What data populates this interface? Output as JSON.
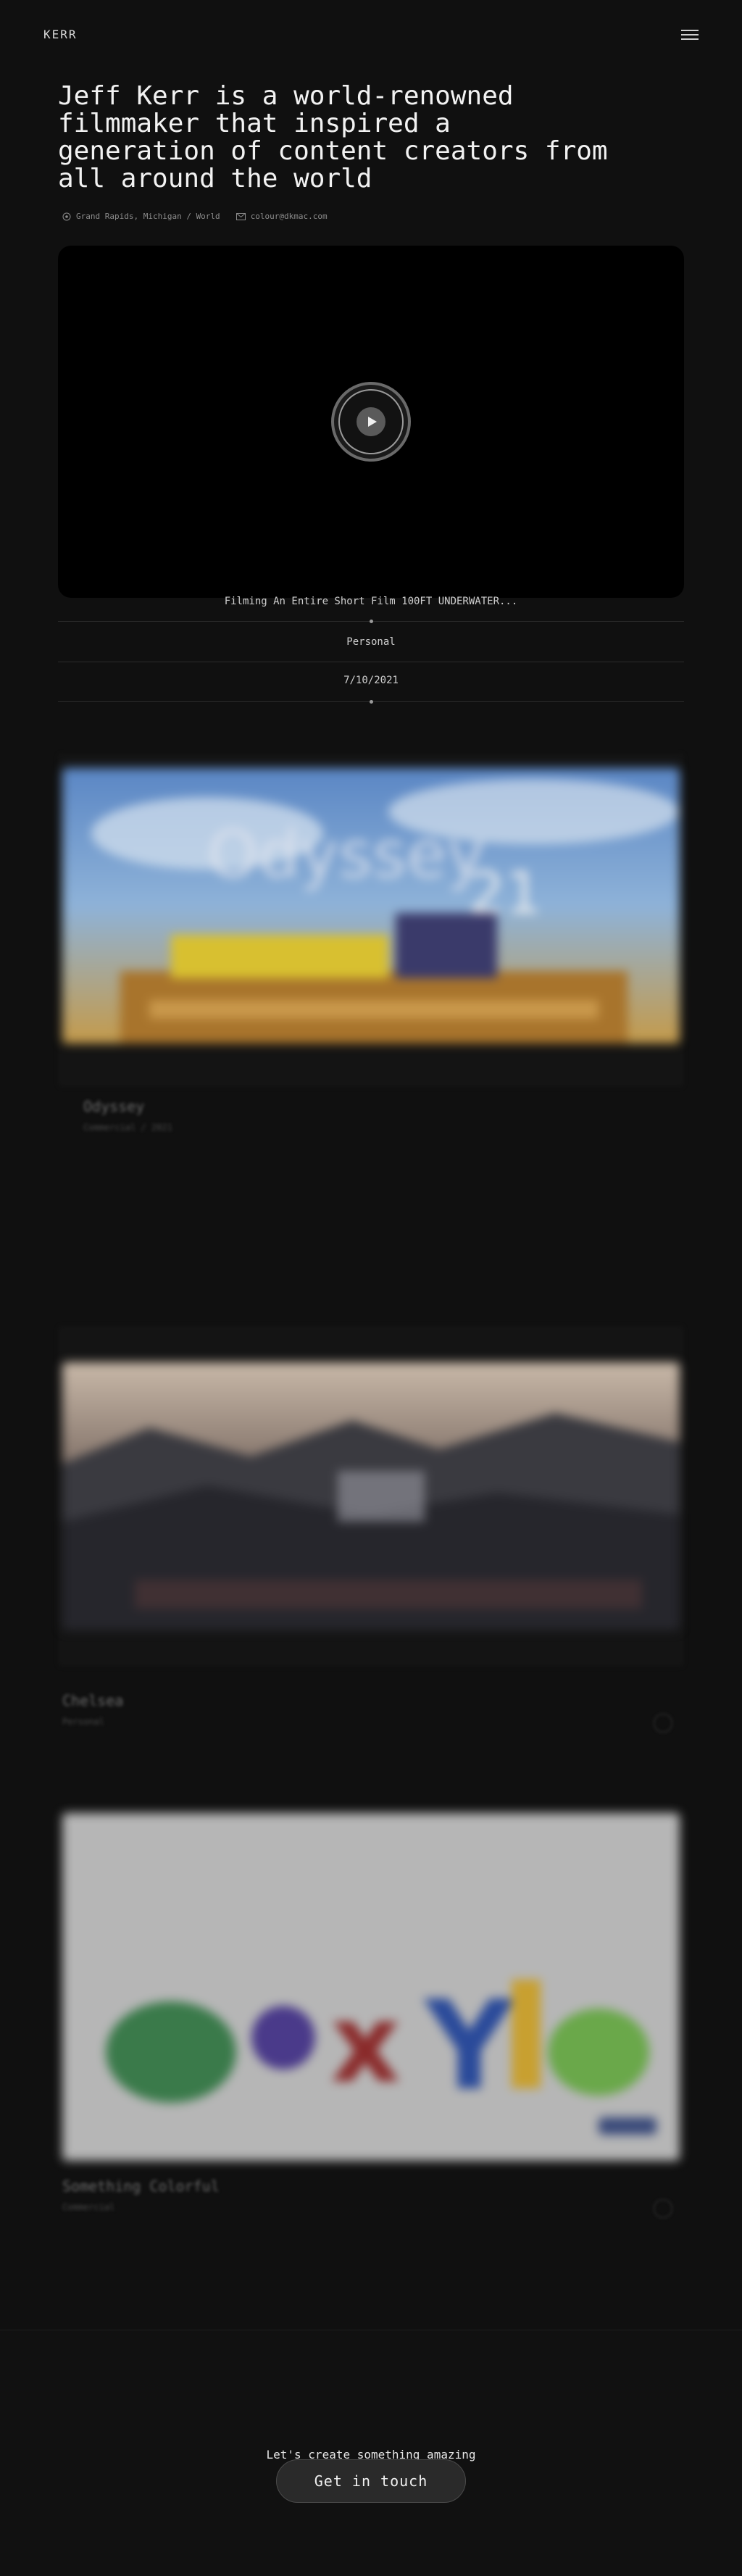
{
  "header": {
    "logo": "KERR",
    "menu_icon": "hamburger-menu-icon"
  },
  "hero": {
    "title": "Jeff Kerr is a world-renowned filmmaker that inspired a generation of content creators from all around the world",
    "location": "Grand Rapids, Michigan / World",
    "location_icon": "location-pin-icon",
    "email": "colour@dkmac.com",
    "email_icon": "mail-icon"
  },
  "featured_video": {
    "title": "Filming An Entire Short Film 100FT UNDERWATER...",
    "category": "Personal",
    "date": "7/10/2021",
    "play_icon": "play-icon"
  },
  "projects": [
    {
      "title": "Odyssey",
      "subtitle": "Commercial / 2021"
    },
    {
      "title": "Chelsea",
      "subtitle": "Personal"
    },
    {
      "title": "Something Colorful",
      "subtitle": "Commercial"
    }
  ],
  "cta": {
    "text": "Let's create something amazing",
    "button": "Get in touch"
  },
  "colors": {
    "background": "#101010",
    "text": "#e8e8e8",
    "muted": "#8c8c8c"
  }
}
